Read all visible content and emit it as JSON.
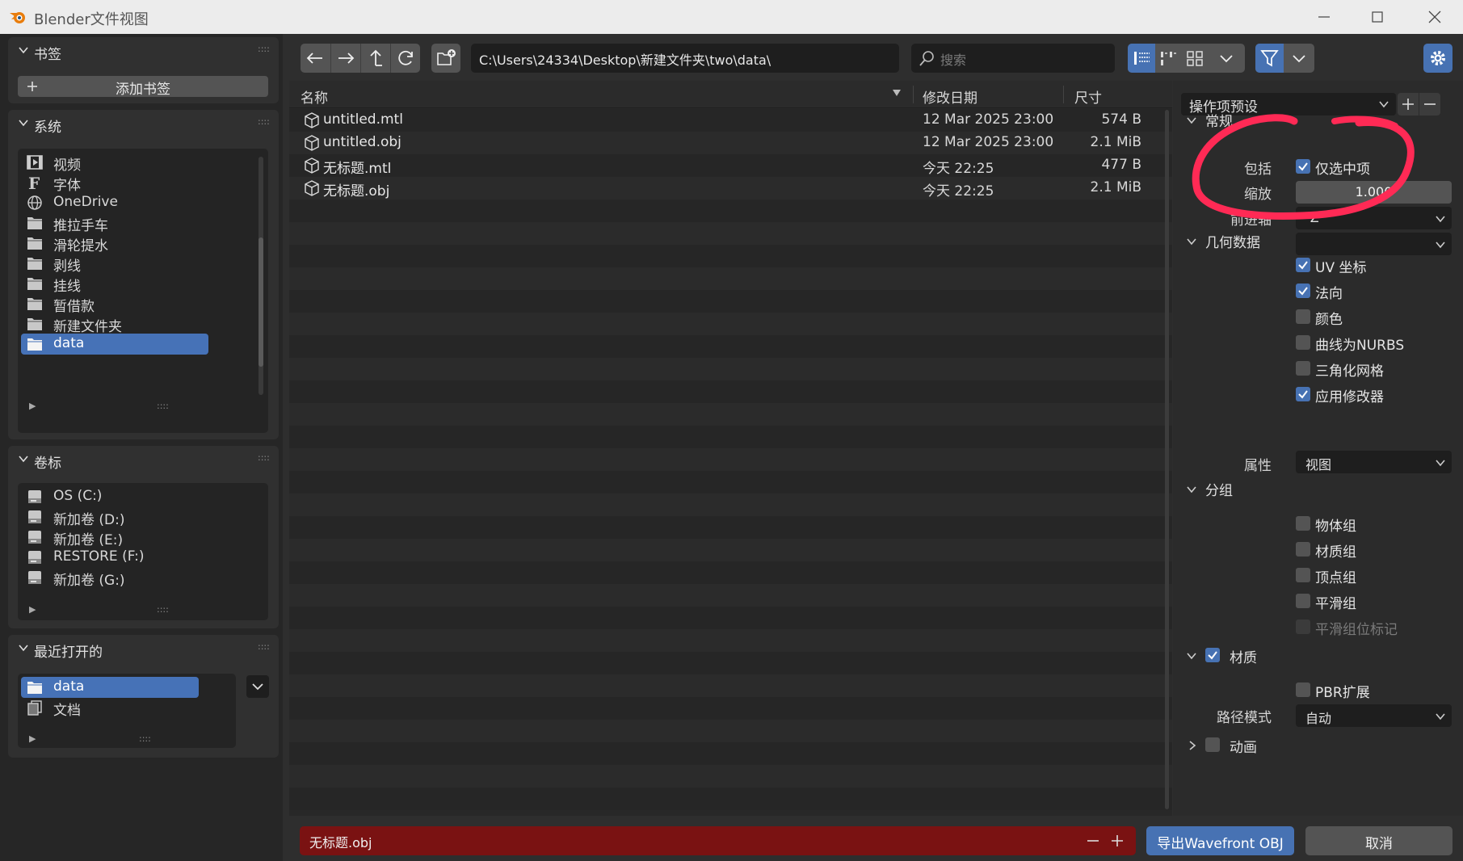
{
  "window": {
    "title": "Blender文件视图"
  },
  "bookmarks": {
    "title": "书签",
    "add_label": "添加书签"
  },
  "system": {
    "title": "系统",
    "items": [
      {
        "label": "视频",
        "icon": "film-icon"
      },
      {
        "label": "字体",
        "icon": "font-icon"
      },
      {
        "label": "OneDrive",
        "icon": "globe-icon"
      },
      {
        "label": "推拉手车",
        "icon": "folder-icon"
      },
      {
        "label": "滑轮提水",
        "icon": "folder-icon"
      },
      {
        "label": "剥线",
        "icon": "folder-icon"
      },
      {
        "label": "挂线",
        "icon": "folder-icon"
      },
      {
        "label": "暂借款",
        "icon": "folder-icon"
      },
      {
        "label": "新建文件夹",
        "icon": "folder-icon"
      },
      {
        "label": "data",
        "icon": "folder-icon",
        "selected": true
      }
    ]
  },
  "volumes": {
    "title": "卷标",
    "items": [
      {
        "label": "OS (C:)"
      },
      {
        "label": "新加卷 (D:)"
      },
      {
        "label": "新加卷 (E:)"
      },
      {
        "label": "RESTORE (F:)"
      },
      {
        "label": "新加卷 (G:)"
      }
    ]
  },
  "recent": {
    "title": "最近打开的",
    "items": [
      {
        "label": "data",
        "icon": "folder-icon",
        "selected": true
      },
      {
        "label": "文档",
        "icon": "documents-icon"
      }
    ]
  },
  "toolbar": {
    "path": "C:\\Users\\24334\\Desktop\\新建文件夹\\two\\data\\",
    "search_placeholder": "搜索"
  },
  "filelist": {
    "headers": {
      "name": "名称",
      "date": "修改日期",
      "size": "尺寸"
    },
    "files": [
      {
        "name": "untitled.mtl",
        "date": "12 Mar 2025 23:00",
        "size": "574 B"
      },
      {
        "name": "untitled.obj",
        "date": "12 Mar 2025 23:00",
        "size": "2.1 MiB"
      },
      {
        "name": "无标题.mtl",
        "date": "今天 22:25",
        "size": "477 B"
      },
      {
        "name": "无标题.obj",
        "date": "今天 22:25",
        "size": "2.1 MiB"
      }
    ]
  },
  "settings": {
    "preset_label": "操作项预设",
    "general": {
      "title": "常规",
      "include_label": "包括",
      "selected_only_label": "仅选中项",
      "selected_only": true,
      "scale_label": "缩放",
      "scale_value": "1.000",
      "forward_label": "前进轴",
      "forward_value": "-Z"
    },
    "geometry": {
      "title": "几何数据",
      "items": [
        {
          "label": "UV 坐标",
          "checked": true
        },
        {
          "label": "法向",
          "checked": true
        },
        {
          "label": "颜色",
          "checked": false
        },
        {
          "label": "曲线为NURBS",
          "checked": false
        },
        {
          "label": "三角化网格",
          "checked": false
        },
        {
          "label": "应用修改器",
          "checked": true
        }
      ],
      "props_label": "属性",
      "props_value": "视图"
    },
    "grouping": {
      "title": "分组",
      "items": [
        {
          "label": "物体组",
          "checked": false
        },
        {
          "label": "材质组",
          "checked": false
        },
        {
          "label": "顶点组",
          "checked": false
        },
        {
          "label": "平滑组",
          "checked": false
        },
        {
          "label": "平滑组位标记",
          "checked": false,
          "disabled": true
        }
      ]
    },
    "materials": {
      "title": "材质",
      "checked": true,
      "pbr_label": "PBR扩展",
      "path_mode_label": "路径模式",
      "path_mode_value": "自动"
    },
    "animation": {
      "title": "动画",
      "checked": false
    }
  },
  "bottom": {
    "filename": "无标题.obj",
    "export_label": "导出Wavefront OBJ",
    "cancel_label": "取消"
  },
  "colors": {
    "accent": "#4772b3",
    "filename_error": "#7a1212",
    "annotation": "#ff2a55"
  }
}
